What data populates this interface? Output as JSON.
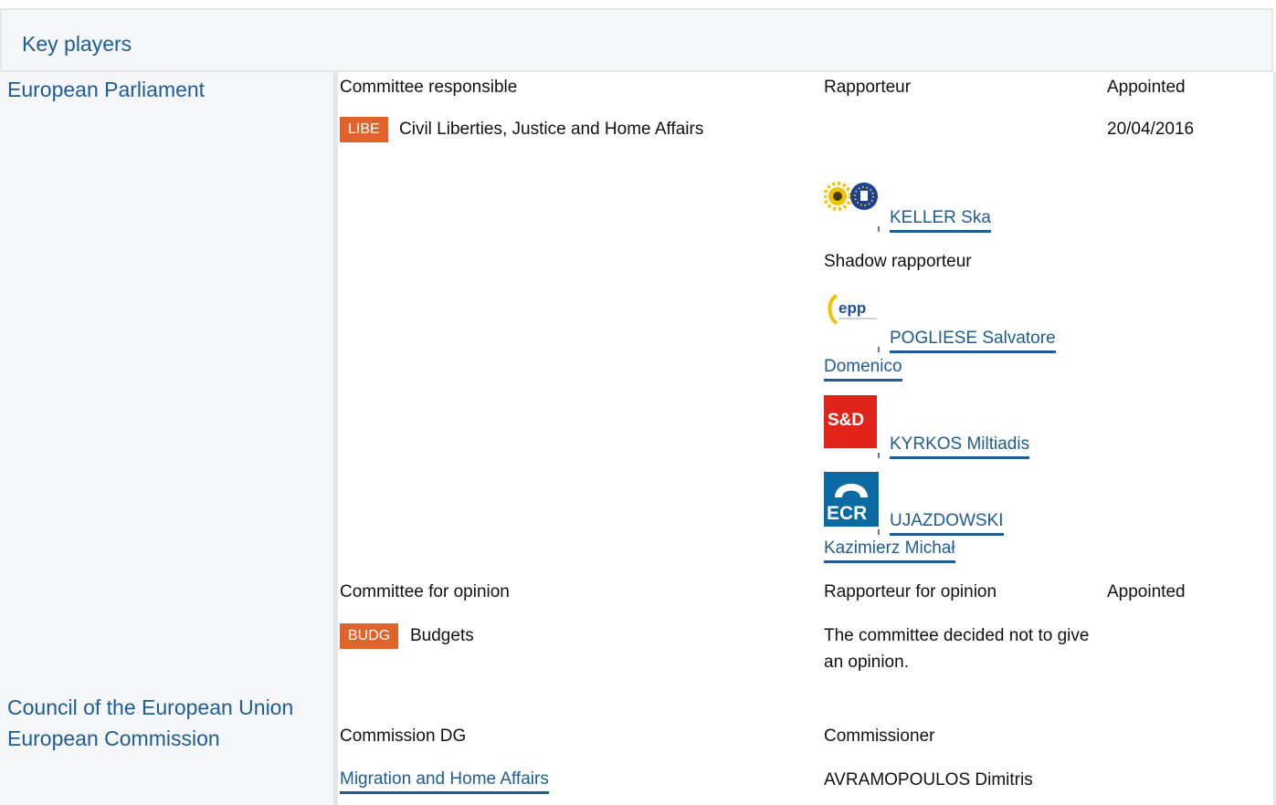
{
  "header": {
    "title": "Key players"
  },
  "institutions": {
    "ep": "European Parliament",
    "council": "Council of the European Union",
    "commission": "European Commission"
  },
  "responsible": {
    "col_committee": "Committee responsible",
    "col_rapporteur": "Rapporteur",
    "col_appointed": "Appointed",
    "badge": "LIBE",
    "committee_name": "Civil Liberties, Justice and Home Affairs",
    "appointed_date": "20/04/2016",
    "rapporteur": {
      "name": "KELLER Ska",
      "group_icon": "greens-efa-logo"
    },
    "shadow_label": "Shadow rapporteur",
    "shadows": [
      {
        "line1": "POGLIESE Salvatore",
        "line2": "Domenico",
        "group_icon": "epp-logo",
        "logo_text": "epp"
      },
      {
        "line1": "KYRKOS Miltiadis",
        "line2": "",
        "group_icon": "sd-logo",
        "logo_text": "S&D"
      },
      {
        "line1": "UJAZDOWSKI",
        "line2": "Kazimierz Michał",
        "group_icon": "ecr-logo",
        "logo_text": "ECR"
      }
    ]
  },
  "opinion": {
    "col_committee": "Committee for opinion",
    "col_rapporteur": "Rapporteur for opinion",
    "col_appointed": "Appointed",
    "badge": "BUDG",
    "committee_name": "Budgets",
    "note": "The committee decided not to give an opinion."
  },
  "commission": {
    "col_dg": "Commission DG",
    "col_commissioner": "Commissioner",
    "dg": "Migration and Home Affairs",
    "commissioner": "AVRAMOPOULOS Dimitris"
  },
  "colors": {
    "accent": "#1d5c94",
    "badge": "#e0632b",
    "panel": "#f4f6f8"
  }
}
